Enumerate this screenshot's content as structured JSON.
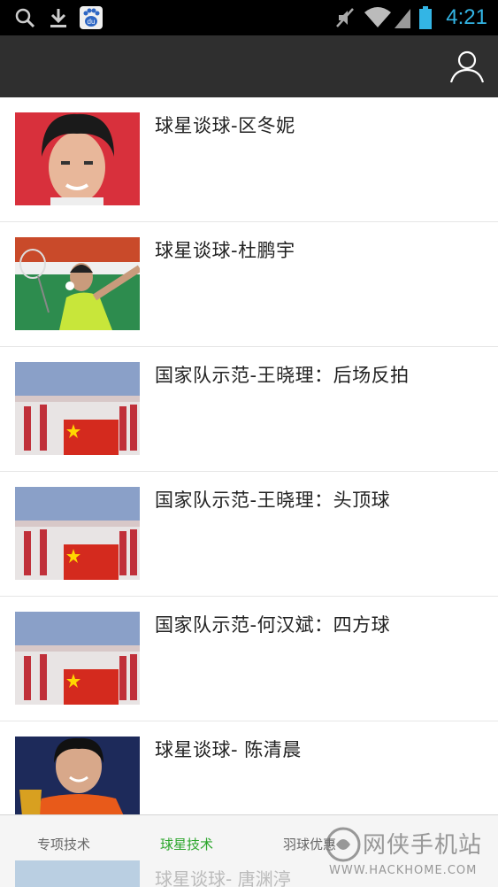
{
  "status_bar": {
    "time": "4:21",
    "icons": [
      "search-icon",
      "download-icon",
      "baidu-app-icon",
      "mute-icon",
      "wifi-icon",
      "signal-icon",
      "battery-icon"
    ],
    "baidu_badge": "du"
  },
  "header": {
    "profile_icon": "user-profile-icon"
  },
  "list": {
    "items": [
      {
        "title": "球星谈球-区冬妮"
      },
      {
        "title": "球星谈球-杜鹏宇"
      },
      {
        "title": "国家队示范-王晓理：后场反拍"
      },
      {
        "title": "国家队示范-王晓理：头顶球"
      },
      {
        "title": "国家队示范-何汉斌：四方球"
      },
      {
        "title": "球星谈球- 陈清晨"
      }
    ],
    "peek_item": "球星谈球- 唐渊渟"
  },
  "tabs": [
    {
      "label": "专项技术",
      "active": false
    },
    {
      "label": "球星技术",
      "active": true
    },
    {
      "label": "羽球优惠",
      "active": false
    }
  ],
  "watermark": {
    "text": "网侠手机站",
    "url": "WWW.HACKHOME.COM"
  },
  "colors": {
    "status_bar_bg": "#000000",
    "header_bg": "#2f2f2f",
    "time": "#33b5e5",
    "active_tab": "#2aa52a"
  }
}
